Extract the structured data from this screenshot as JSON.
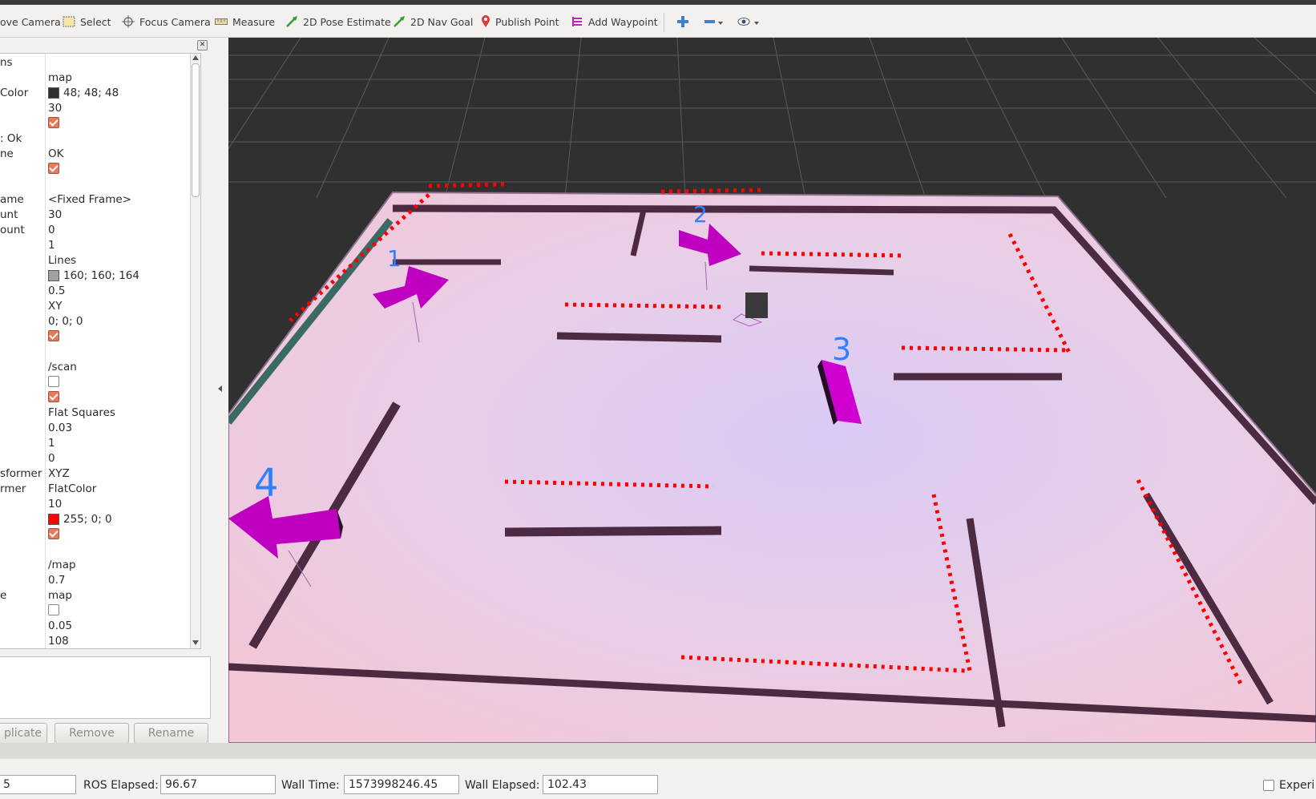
{
  "toolbar": {
    "tools": [
      {
        "label": "ove Camera",
        "icon": "move-camera-icon"
      },
      {
        "label": "Select",
        "icon": "select-icon"
      },
      {
        "label": "Focus Camera",
        "icon": "focus-camera-icon"
      },
      {
        "label": "Measure",
        "icon": "measure-icon"
      },
      {
        "label": "2D Pose Estimate",
        "icon": "pose-estimate-icon"
      },
      {
        "label": "2D Nav Goal",
        "icon": "nav-goal-icon"
      },
      {
        "label": "Publish Point",
        "icon": "publish-point-icon"
      },
      {
        "label": "Add Waypoint",
        "icon": "add-waypoint-icon"
      }
    ]
  },
  "displays": {
    "rows": [
      {
        "name": "ns",
        "value": ""
      },
      {
        "name": "",
        "value": "map"
      },
      {
        "name": "Color",
        "value": "48; 48; 48",
        "swatch": "#303030"
      },
      {
        "name": "",
        "value": "30"
      },
      {
        "name": "",
        "value": "",
        "checkbox": true
      },
      {
        "name": ": Ok",
        "value": ""
      },
      {
        "name": "ne",
        "value": "OK"
      },
      {
        "name": "",
        "value": "",
        "checkbox": true
      },
      {
        "name": "",
        "value": ""
      },
      {
        "name": "ame",
        "value": "<Fixed Frame>"
      },
      {
        "name": "unt",
        "value": "30"
      },
      {
        "name": "ount",
        "value": "0"
      },
      {
        "name": "",
        "value": "1"
      },
      {
        "name": "",
        "value": "Lines"
      },
      {
        "name": "",
        "value": "160; 160; 164",
        "swatch": "#a0a0a4"
      },
      {
        "name": "",
        "value": "0.5"
      },
      {
        "name": "",
        "value": "XY"
      },
      {
        "name": "",
        "value": "0; 0; 0"
      },
      {
        "name": "",
        "value": "",
        "checkbox": true
      },
      {
        "name": "",
        "value": ""
      },
      {
        "name": "",
        "value": "/scan"
      },
      {
        "name": "",
        "value": "",
        "checkbox": false
      },
      {
        "name": "",
        "value": "",
        "checkbox": true
      },
      {
        "name": "",
        "value": "Flat Squares"
      },
      {
        "name": "",
        "value": "0.03"
      },
      {
        "name": "",
        "value": "1"
      },
      {
        "name": "",
        "value": "0"
      },
      {
        "name": "sformer",
        "value": "XYZ"
      },
      {
        "name": "rmer",
        "value": "FlatColor"
      },
      {
        "name": "",
        "value": "10"
      },
      {
        "name": "",
        "value": "255; 0; 0",
        "swatch": "#ff0000"
      },
      {
        "name": "",
        "value": "",
        "checkbox": true
      },
      {
        "name": "",
        "value": ""
      },
      {
        "name": "",
        "value": "/map"
      },
      {
        "name": "",
        "value": "0.7"
      },
      {
        "name": "e",
        "value": "map"
      },
      {
        "name": "",
        "value": "",
        "checkbox": false
      },
      {
        "name": "",
        "value": "0.05"
      },
      {
        "name": "",
        "value": "108"
      }
    ]
  },
  "buttons": {
    "duplicate": "plicate",
    "remove": "Remove",
    "rename": "Rename"
  },
  "viewport": {
    "waypoints": [
      "1",
      "2",
      "3",
      "4"
    ],
    "colors": {
      "background": "#303030",
      "arrow": "#cc00cc",
      "scan": "#ff0000",
      "label": "#2f7fff"
    }
  },
  "status": {
    "ros_time_value": "5",
    "ros_elapsed_label": "ROS Elapsed:",
    "ros_elapsed_value": "96.67",
    "wall_time_label": "Wall Time:",
    "wall_time_value": "1573998246.45",
    "wall_elapsed_label": "Wall Elapsed:",
    "wall_elapsed_value": "102.43",
    "experimental_label": "Experi"
  }
}
